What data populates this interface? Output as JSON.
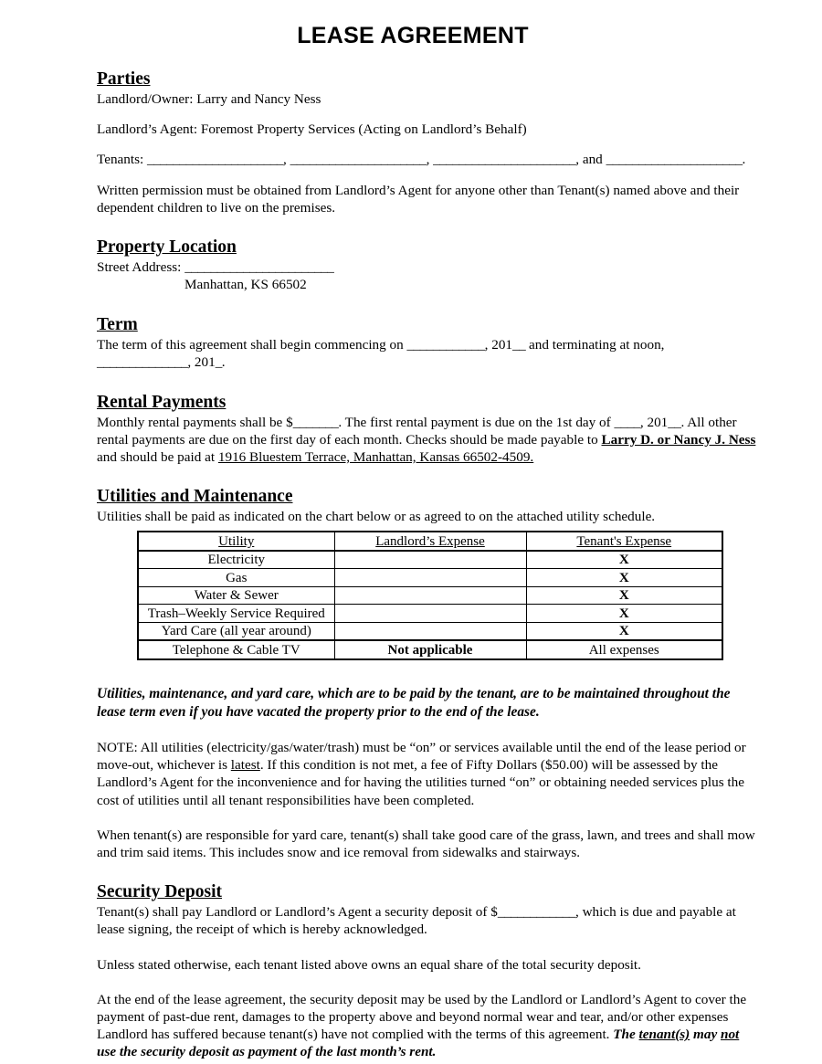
{
  "document": {
    "title": "LEASE AGREEMENT"
  },
  "parties": {
    "heading": "Parties",
    "landlord_line": "Landlord/Owner: Larry and Nancy Ness",
    "agent_line": "Landlord’s Agent: Foremost Property Services (Acting on Landlord’s Behalf)",
    "tenants_label": "Tenants:",
    "tenants_blank_1": "_____________________",
    "tenants_blank_2": "_____________________",
    "tenants_blank_3": "______________________",
    "tenants_conjunction": ", and",
    "tenants_blank_4": "_____________________",
    "tenants_tail": ".",
    "tenants_sep_1": ",",
    "tenants_sep_2": ",",
    "written_permission": "Written permission must be obtained from Landlord’s Agent for anyone other than Tenant(s) named above and their dependent children to live on the premises."
  },
  "property_location": {
    "heading": "Property Location ",
    "street_label": "Street Address:",
    "street_blank": "_______________________",
    "city_state_zip": "Manhattan, KS  66502"
  },
  "term": {
    "heading": "Term",
    "text_1": "The term of this agreement shall begin commencing on ",
    "blank_1": "____________",
    "text_2": ", 201",
    "blank_2": "__",
    "text_3": " and terminating at noon, ",
    "blank_3": "______________",
    "text_4": ", 201",
    "blank_4": "_",
    "text_5": "."
  },
  "rental_payments": {
    "heading": "Rental Payments",
    "text_1": "Monthly rental payments shall be $",
    "blank_amount": "_______",
    "text_2": ".  The first rental payment is due on the 1st day of ",
    "blank_month": "____",
    "text_3": ", 201",
    "blank_year": "__",
    "text_4": ".  All other rental payments are due on the first day of each month.  Checks should be made payable to ",
    "payee": "Larry D. or Nancy J. Ness",
    "text_5": " and should be paid at ",
    "payment_address": "1916 Bluestem Terrace, Manhattan, Kansas 66502-4509.",
    "text_6": ""
  },
  "utilities": {
    "heading": "Utilities and Maintenance",
    "intro": "Utilities shall be paid as indicated on the chart below or as agreed to on the attached utility schedule.",
    "table": {
      "columns": [
        "Utility",
        "Landlord’s Expense",
        "Tenant's Expense"
      ],
      "rows": [
        {
          "utility": "Electricity",
          "landlord": "",
          "tenant": "X"
        },
        {
          "utility": "Gas",
          "landlord": "",
          "tenant": "X"
        },
        {
          "utility": "Water & Sewer",
          "landlord": "",
          "tenant": "X"
        },
        {
          "utility": "Trash–Weekly Service Required",
          "landlord": "",
          "tenant": "X"
        },
        {
          "utility": "Yard Care (all year around)",
          "landlord": "",
          "tenant": "X"
        },
        {
          "utility": "Telephone & Cable TV",
          "landlord": "Not applicable",
          "tenant": "All expenses"
        }
      ]
    },
    "emphasis_note": "Utilities, maintenance, and yard care, which are to be paid by the tenant, are to be maintained throughout the lease term even if you have vacated the property prior to the end of the lease.",
    "note_text_1": "NOTE:  All utilities (electricity/gas/water/trash) must be “on” or services available until the end of the lease period or move-out, whichever is ",
    "note_underlined": "latest",
    "note_text_2": ".  If this condition is not met, a fee of Fifty Dollars ($50.00) will be assessed by the Landlord’s Agent for the inconvenience and for having the utilities turned “on” or obtaining needed services plus the cost of utilities until all tenant responsibilities have been completed.",
    "yard_care_note": "When tenant(s) are responsible for yard care, tenant(s) shall take good care of the grass, lawn, and trees and shall mow and trim said items.  This includes snow and ice removal from sidewalks and stairways."
  },
  "security_deposit": {
    "heading": "Security Deposit",
    "text_1": "Tenant(s) shall pay Landlord or Landlord’s Agent a security deposit of $",
    "blank_amount": "____________",
    "text_2": ", which is due and payable at lease signing, the receipt of which is hereby acknowledged.",
    "equal_share": "Unless stated otherwise, each tenant listed above owns an equal share of the total security deposit.",
    "end_text_1": "At the end of the lease agreement, the security deposit may be used by the Landlord or Landlord’s Agent to cover the payment of past-due rent, damages to the property above and beyond normal wear and tear, and/or other expenses Landlord has suffered because tenant(s) have not complied with the terms of this agreement.  ",
    "emph_1": "The ",
    "emph_underline_1": "tenant(s)",
    "emph_2": " may ",
    "emph_underline_2": "not",
    "emph_3": " use the security deposit as payment of the last month’s rent."
  }
}
